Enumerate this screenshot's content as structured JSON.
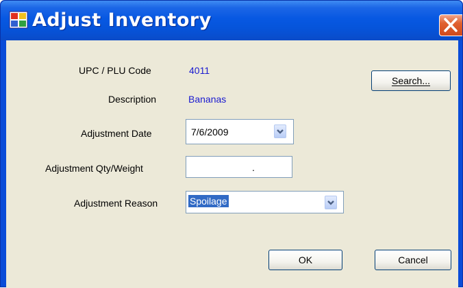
{
  "window": {
    "title": "Adjust Inventory"
  },
  "fields": {
    "upc_label": "UPC / PLU Code",
    "upc_value": "4011",
    "description_label": "Description",
    "description_value": "Bananas",
    "date_label": "Adjustment Date",
    "date_value": "7/6/2009",
    "qty_label": "Adjustment Qty/Weight",
    "qty_value": ".",
    "reason_label": "Adjustment Reason",
    "reason_value": "Spoilage"
  },
  "buttons": {
    "search": "Search...",
    "ok": "OK",
    "cancel": "Cancel"
  },
  "colors": {
    "titlebar": "#0758e2",
    "client_background": "#ece9d8",
    "value_text": "#1a1ad0",
    "close_button": "#d04a1c",
    "selection": "#316ac5"
  },
  "icons": {
    "app": "app-window-icon",
    "close": "close-icon",
    "dropdown": "chevron-down-icon"
  }
}
